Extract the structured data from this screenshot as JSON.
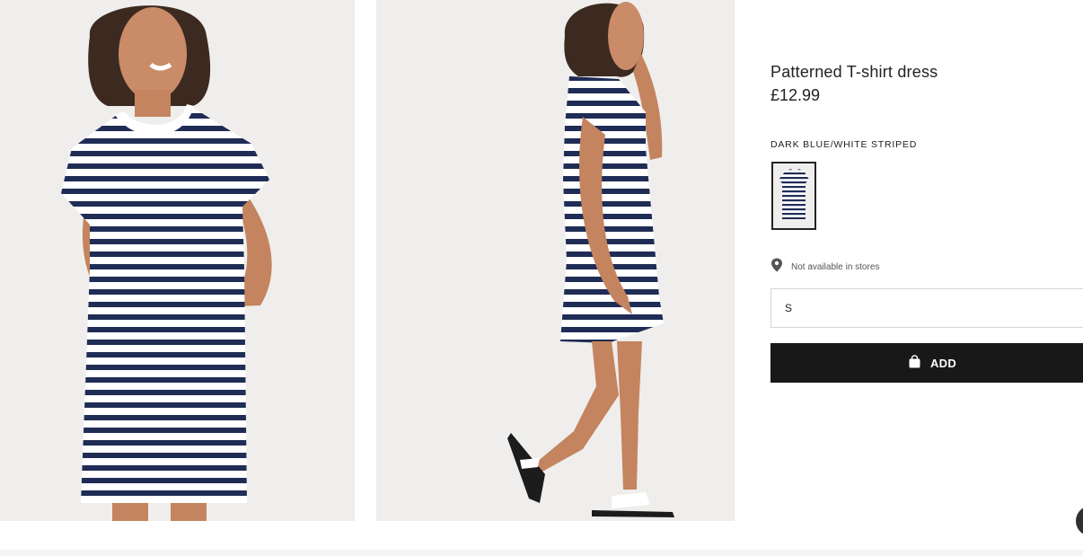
{
  "product": {
    "title": "Patterned T-shirt dress",
    "price": "£12.99",
    "color_name": "DARK BLUE/WHITE STRIPED",
    "store_availability": "Not available in stores",
    "selected_size": "S",
    "add_button_label": "ADD"
  },
  "colors": {
    "stripe_navy": "#1f2c55",
    "stripe_white": "#ffffff",
    "add_button_bg": "#181818",
    "photo_bg": "#efeeec"
  },
  "icons": {
    "store": "location-pin-icon",
    "add": "shopping-bag-icon"
  }
}
